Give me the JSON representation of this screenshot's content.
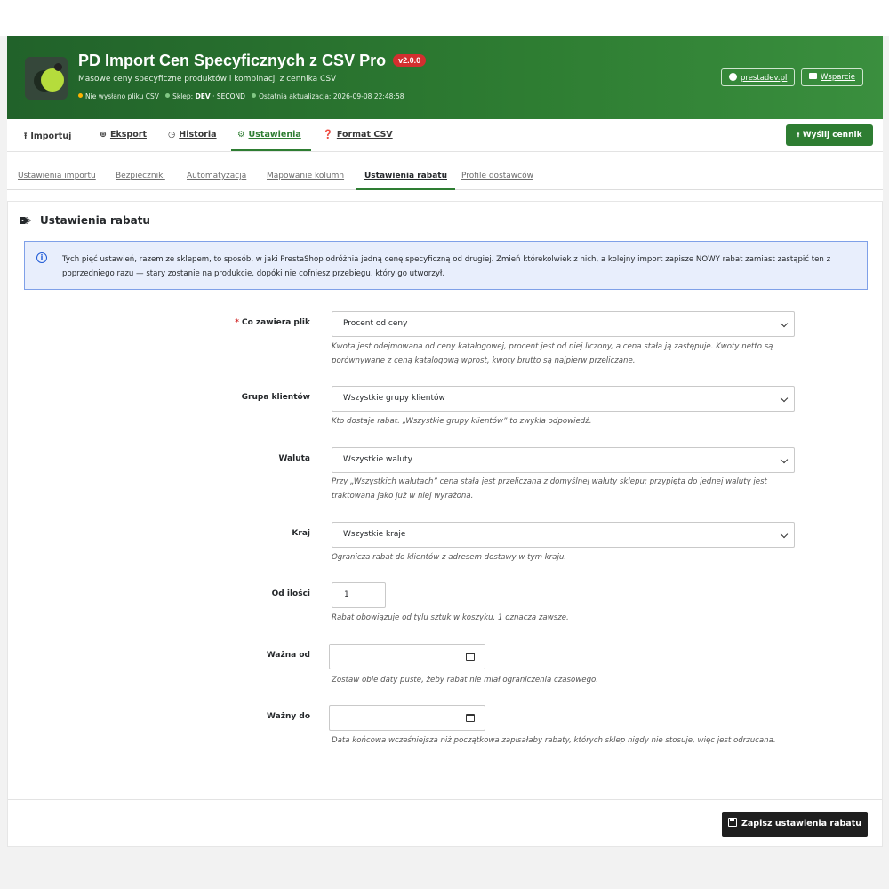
{
  "header": {
    "title": "PD Import Cen Specyficznych z CSV Pro",
    "version": "v2.0.0",
    "subtitle": "Masowe ceny specyficzne produktów i kombinacji z cennika CSV",
    "status_no_file": "Nie wysłano pliku CSV",
    "shop_label": "Sklep:",
    "shop_env": "DEV",
    "shop_sep": "·",
    "shop_name": "SECOND",
    "last_update": "Ostatnia aktualizacja: 2026-09-08 22:48:58",
    "link_site": "prestadev.pl",
    "link_support": "Wsparcie"
  },
  "nav": {
    "items": [
      {
        "label": "Importuj",
        "icon": "upload-icon"
      },
      {
        "label": "Eksport",
        "icon": "download-circle-icon"
      },
      {
        "label": "Historia",
        "icon": "clock-icon"
      },
      {
        "label": "Ustawienia",
        "icon": "cogs-icon"
      },
      {
        "label": "Format CSV",
        "icon": "question-icon"
      }
    ],
    "active": "Ustawienia",
    "send_button": "Wyślij cennik"
  },
  "subtabs": {
    "items": [
      "Ustawienia importu",
      "Bezpieczniki",
      "Automatyzacja",
      "Mapowanie kolumn",
      "Ustawienia rabatu",
      "Profile dostawców"
    ],
    "active": "Ustawienia rabatu"
  },
  "panel": {
    "title": "Ustawienia rabatu",
    "info": "Tych pięć ustawień, razem ze sklepem, to sposób, w jaki PrestaShop odróżnia jedną cenę specyficzną od drugiej. Zmień którekolwiek z nich, a kolejny import zapisze NOWY rabat zamiast zastąpić ten z poprzedniego razu — stary zostanie na produkcie, dopóki nie cofniesz przebiegu, który go utworzył.",
    "fields": {
      "content": {
        "required_mark": "*",
        "label": "Co zawiera plik",
        "value": "Procent od ceny",
        "help": "Kwota jest odejmowana od ceny katalogowej, procent jest od niej liczony, a cena stała ją zastępuje. Kwoty netto są porównywane z ceną katalogową wprost, kwoty brutto są najpierw przeliczane."
      },
      "group": {
        "label": "Grupa klientów",
        "value": "Wszystkie grupy klientów",
        "help": "Kto dostaje rabat. „Wszystkie grupy klientów” to zwykła odpowiedź."
      },
      "currency": {
        "label": "Waluta",
        "value": "Wszystkie waluty",
        "help": "Przy „Wszystkich walutach” cena stała jest przeliczana z domyślnej waluty sklepu; przypięta do jednej waluty jest traktowana jako już w niej wyrażona."
      },
      "country": {
        "label": "Kraj",
        "value": "Wszystkie kraje",
        "help": "Ogranicza rabat do klientów z adresem dostawy w tym kraju."
      },
      "quantity": {
        "label": "Od ilości",
        "value": "1",
        "help": "Rabat obowiązuje od tylu sztuk w koszyku. 1 oznacza zawsze."
      },
      "from": {
        "label": "Ważna od",
        "value": "",
        "help": "Zostaw obie daty puste, żeby rabat nie miał ograniczenia czasowego."
      },
      "to": {
        "label": "Ważny do",
        "value": "",
        "help": "Data końcowa wcześniejsza niż początkowa zapisałaby rabaty, których sklep nigdy nie stosuje, więc jest odrzucana."
      }
    },
    "save_button": "Zapisz ustawienia rabatu"
  },
  "colors": {
    "brand_green": "#2e7d32",
    "badge_red": "#d32f2f",
    "info_blue": "#1f5ad6"
  }
}
